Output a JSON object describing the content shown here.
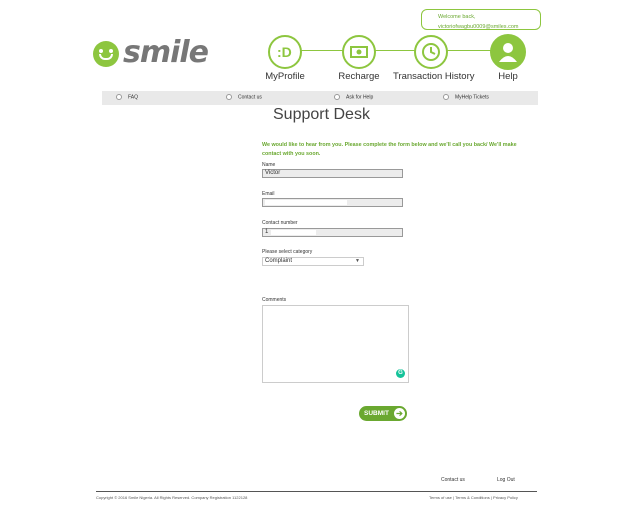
{
  "header": {
    "welcome_line1": "Welcome back,",
    "welcome_line2": "victoriofwagbu0009@smiles.com",
    "logo_text": "smile"
  },
  "nav": [
    {
      "label": "MyProfile",
      "icon": ":D"
    },
    {
      "label": "Recharge",
      "icon": "money-icon"
    },
    {
      "label": "Transaction History",
      "icon": "clock-icon"
    },
    {
      "label": "Help",
      "icon": "user-icon"
    }
  ],
  "subnav": [
    "FAQ",
    "Contact us",
    "Ask for Help",
    "MyHelp Tickets"
  ],
  "page_title": "Support Desk",
  "intro": "We would like to hear from you. Please complete the form below and we'll call you back/ We'll make contact with you soon.",
  "form": {
    "name_label": "Name",
    "name_value": "Victor",
    "email_label": "Email",
    "contact_label": "Contact number",
    "contact_value": "1",
    "category_label": "Please select category",
    "category_value": "Complaint",
    "comments_label": "Comments",
    "submit_label": "SUBMIT"
  },
  "footer": {
    "contact_us": "Contact us",
    "log_out": "Log Out",
    "copyright": "Copyright © 2016 Smile Nigeria. All Rights Reserved. Company Registration 1122128",
    "legal": "Terms of use | Terms & Conditions | Privacy Policy"
  },
  "colors": {
    "brand_green": "#8dc63f",
    "dark_green": "#6aa830"
  }
}
